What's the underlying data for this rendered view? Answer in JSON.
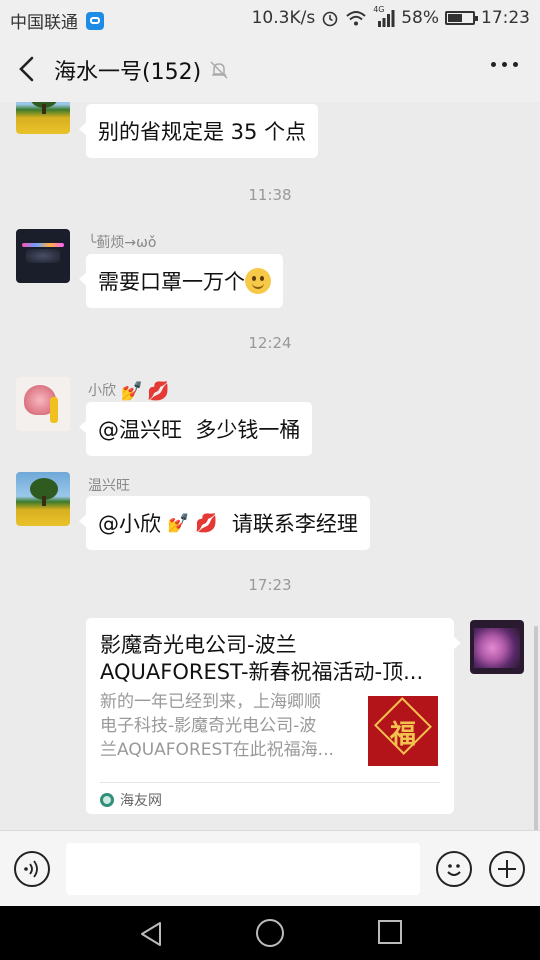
{
  "status_bar": {
    "carrier": "中国联通",
    "speed": "10.3K/s",
    "network": "4G",
    "battery_percent": "58%",
    "battery_level": 0.58,
    "time": "17:23"
  },
  "header": {
    "title": "海水一号(152)"
  },
  "messages": [
    {
      "type": "text",
      "text": "别的省规定是 35 个点"
    },
    {
      "type": "time",
      "text": "11:38"
    },
    {
      "type": "text",
      "sender": "╰蓟烦→ωǒ",
      "text": "需要口罩一万个"
    },
    {
      "type": "time",
      "text": "12:24"
    },
    {
      "type": "text",
      "sender": "小欣",
      "text": "@温兴旺  多少钱一桶"
    },
    {
      "type": "text",
      "sender": "温兴旺",
      "text_prefix": "@小欣",
      "text_suffix": "请联系李经理"
    },
    {
      "type": "time",
      "text": "17:23"
    }
  ],
  "card": {
    "title_line1": "影魔奇光电公司-波兰",
    "title_line2": "AQUAFOREST-新春祝福活动-顶...",
    "desc_line1": "新的一年已经到来，上海卿顺",
    "desc_line2": "电子科技-影魔奇光电公司-波",
    "desc_line3": "兰AQUAFOREST在此祝福海...",
    "thumb_text": "福",
    "source": "海友网"
  },
  "icons": {
    "back": "chevron-left-icon",
    "mute": "mute-bell-icon",
    "more": "more-dots-icon",
    "voice": "voice-icon",
    "emoji": "emoji-icon",
    "plus": "plus-icon"
  },
  "colors": {
    "background": "#ebebeb",
    "bubble": "#ffffff",
    "card_thumb": "#b3141a"
  }
}
